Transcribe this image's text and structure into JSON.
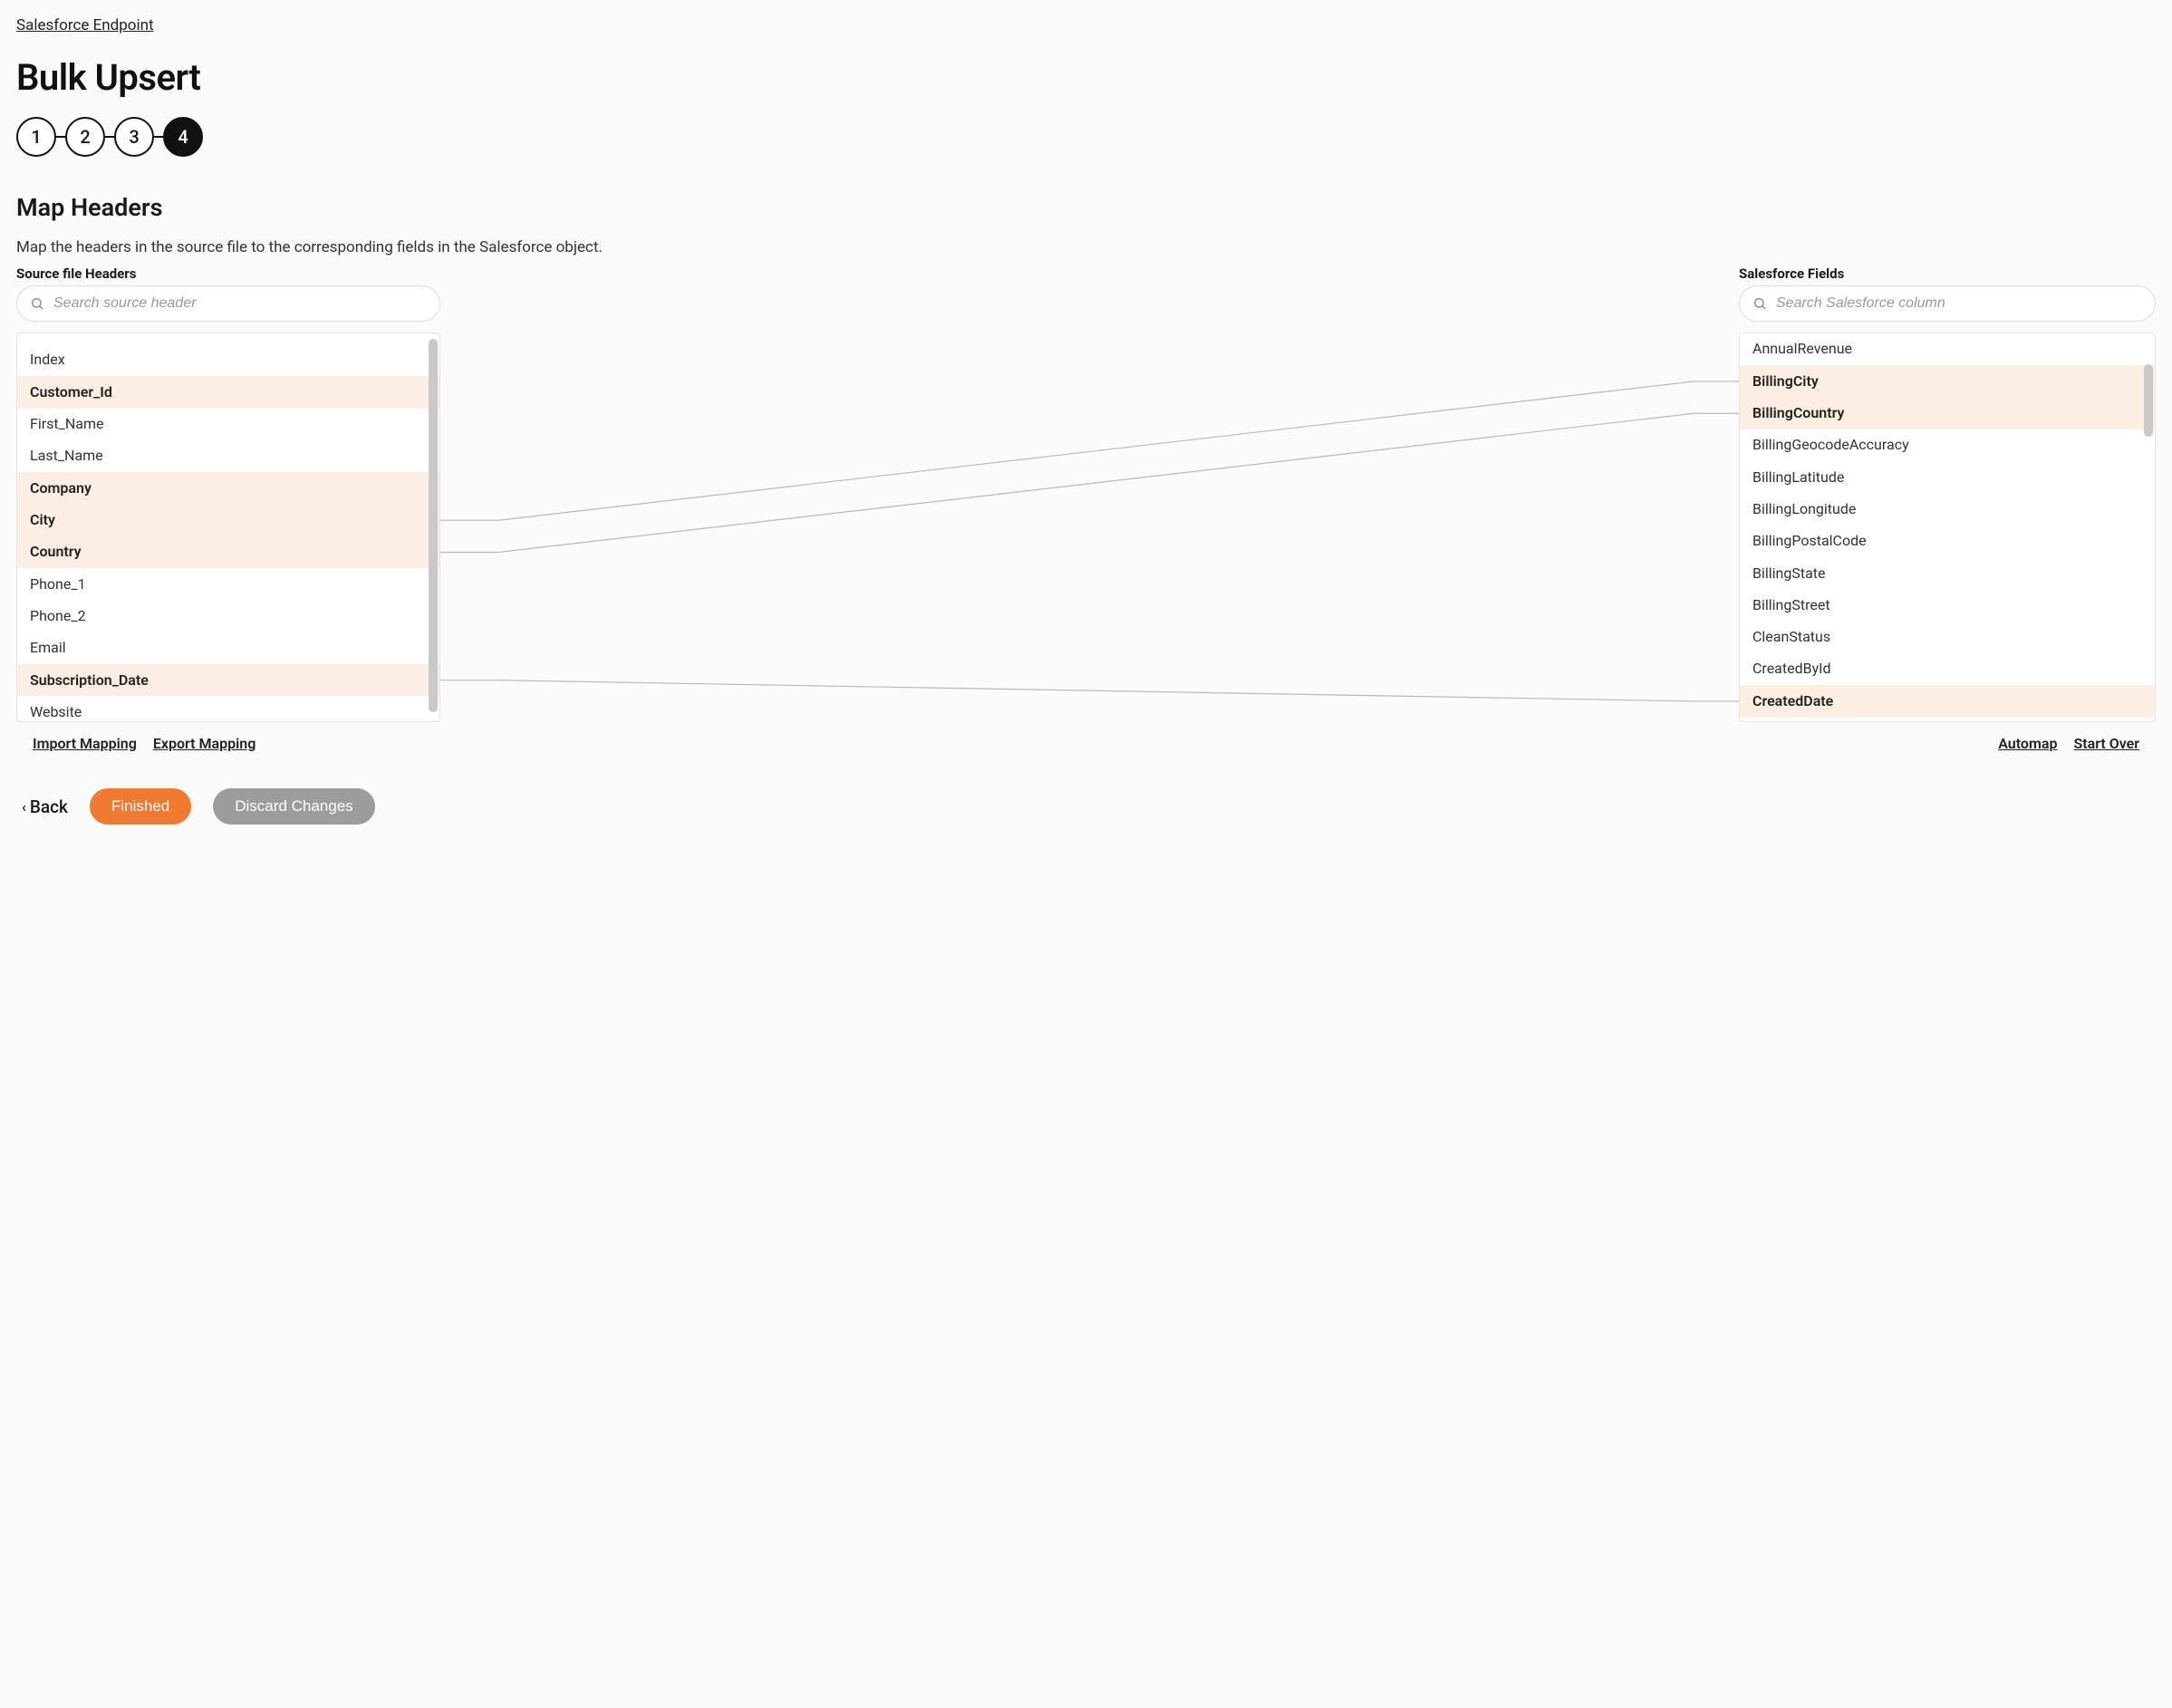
{
  "breadcrumb": "Salesforce Endpoint",
  "page_title": "Bulk Upsert",
  "stepper": {
    "steps": [
      "1",
      "2",
      "3",
      "4"
    ],
    "active_index": 3
  },
  "section_title": "Map Headers",
  "description": "Map the headers in the source file to the corresponding fields in the Salesforce object.",
  "left_column": {
    "label": "Source file Headers",
    "search_placeholder": "Search source header",
    "items": [
      {
        "label": "Index",
        "mapped": false
      },
      {
        "label": "Customer_Id",
        "mapped": true
      },
      {
        "label": "First_Name",
        "mapped": false
      },
      {
        "label": "Last_Name",
        "mapped": false
      },
      {
        "label": "Company",
        "mapped": true
      },
      {
        "label": "City",
        "mapped": true
      },
      {
        "label": "Country",
        "mapped": true
      },
      {
        "label": "Phone_1",
        "mapped": false
      },
      {
        "label": "Phone_2",
        "mapped": false
      },
      {
        "label": "Email",
        "mapped": false
      },
      {
        "label": "Subscription_Date",
        "mapped": true
      },
      {
        "label": "Website",
        "mapped": false
      }
    ]
  },
  "right_column": {
    "label": "Salesforce Fields",
    "search_placeholder": "Search Salesforce column",
    "items": [
      {
        "label": "AnnualRevenue",
        "mapped": false
      },
      {
        "label": "BillingCity",
        "mapped": true
      },
      {
        "label": "BillingCountry",
        "mapped": true
      },
      {
        "label": "BillingGeocodeAccuracy",
        "mapped": false
      },
      {
        "label": "BillingLatitude",
        "mapped": false
      },
      {
        "label": "BillingLongitude",
        "mapped": false
      },
      {
        "label": "BillingPostalCode",
        "mapped": false
      },
      {
        "label": "BillingState",
        "mapped": false
      },
      {
        "label": "BillingStreet",
        "mapped": false
      },
      {
        "label": "CleanStatus",
        "mapped": false
      },
      {
        "label": "CreatedById",
        "mapped": false
      },
      {
        "label": "CreatedDate",
        "mapped": true
      }
    ]
  },
  "connections": [
    {
      "from": 5,
      "to": 1
    },
    {
      "from": 6,
      "to": 2
    },
    {
      "from": 10,
      "to": 11
    }
  ],
  "actions": {
    "import_mapping": "Import Mapping",
    "export_mapping": "Export Mapping",
    "automap": "Automap",
    "start_over": "Start Over"
  },
  "footer": {
    "back": "Back",
    "finished": "Finished",
    "discard": "Discard Changes"
  }
}
